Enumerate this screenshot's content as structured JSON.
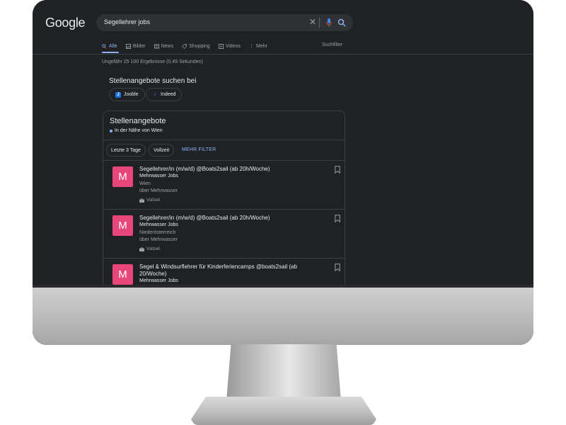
{
  "google": {
    "logo_text": "Google",
    "search_query": "Segellehrer jobs"
  },
  "tabs": [
    {
      "label": "Alle",
      "icon": "search-icon",
      "active": true
    },
    {
      "label": "Bilder",
      "icon": "image-icon",
      "active": false
    },
    {
      "label": "News",
      "icon": "news-icon",
      "active": false
    },
    {
      "label": "Shopping",
      "icon": "tag-icon",
      "active": false
    },
    {
      "label": "Videos",
      "icon": "play-icon",
      "active": false
    },
    {
      "label": "Mehr",
      "icon": "more-vert-icon",
      "active": false
    }
  ],
  "tools_label": "Suchfilter",
  "results_count": "Ungefähr 25 100 Ergebnisse (0,49 Sekunden)",
  "providers": {
    "title": "Stellenangebote suchen bei",
    "items": [
      {
        "label": "Jooble",
        "icon": "jooble-logo",
        "color": "#1a73e8"
      },
      {
        "label": "Indeed",
        "icon": "indeed-logo",
        "color": "#2557a7"
      }
    ]
  },
  "jobs": {
    "title": "Stellenangebote",
    "location": "In der Nähe von Wien",
    "filters": [
      "Letzte 3 Tage",
      "Vollzeit"
    ],
    "more_filters": "MEHR FILTER",
    "listings": [
      {
        "logo_letter": "M",
        "title": "Segellehrer/in (m/w/d) @Boats2sail (ab 20h/Woche)",
        "company": "Mehrwasser Jobs",
        "location": "Wien",
        "source": "über Mehrwasser",
        "type": "Vollzeit"
      },
      {
        "logo_letter": "M",
        "title": "Segellehrer/in (m/w/d) @Boats2sail (ab 20h/Woche)",
        "company": "Mehrwasser Jobs",
        "location": "Niederösterreich",
        "source": "über Mehrwasser",
        "type": "Vollzeit"
      },
      {
        "logo_letter": "M",
        "title": "Segel & Windsurflehrer für Kinderferiencamps @boats2sail (ab 20/Woche)",
        "company": "Mehrwasser Jobs"
      }
    ]
  },
  "colors": {
    "background": "#202124",
    "accent": "#8ab4f8",
    "logo_pink": "#e8457a"
  }
}
